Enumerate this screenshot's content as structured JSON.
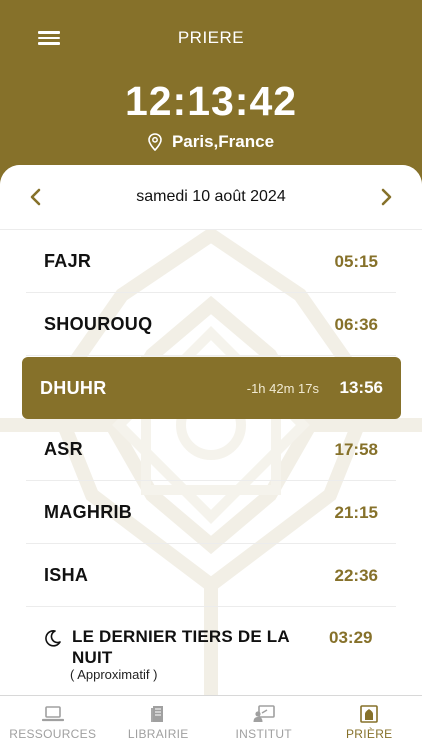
{
  "header": {
    "title": "PRIERE",
    "clock": "12:13:42",
    "location": "Paris,France",
    "menu_icon": "hamburger-menu-icon",
    "location_icon": "map-pin-icon"
  },
  "date_nav": {
    "date": "samedi 10 août 2024",
    "prev_icon": "chevron-left-icon",
    "next_icon": "chevron-right-icon"
  },
  "prayers": [
    {
      "name": "FAJR",
      "time": "05:15"
    },
    {
      "name": "SHOUROUQ",
      "time": "06:36"
    },
    {
      "name": "DHUHR",
      "time": "13:56",
      "countdown": "-1h 42m 17s",
      "active": true
    },
    {
      "name": "ASR",
      "time": "17:58"
    },
    {
      "name": "MAGHRIB",
      "time": "21:15"
    },
    {
      "name": "ISHA",
      "time": "22:36"
    }
  ],
  "last_third": {
    "name": "LE DERNIER TIERS DE LA NUIT",
    "time": "03:29",
    "note": "( Approximatif )",
    "icon": "moon-icon"
  },
  "tabs": [
    {
      "label": "RESSOURCES",
      "icon": "laptop-icon"
    },
    {
      "label": "LIBRAIRIE",
      "icon": "book-icon"
    },
    {
      "label": "INSTITUT",
      "icon": "teacher-icon"
    },
    {
      "label": "PRIÈRE",
      "icon": "mosque-icon",
      "active": true
    }
  ],
  "colors": {
    "brand": "#86712a",
    "inactive_tab": "#a0a0a0",
    "text": "#111111"
  }
}
